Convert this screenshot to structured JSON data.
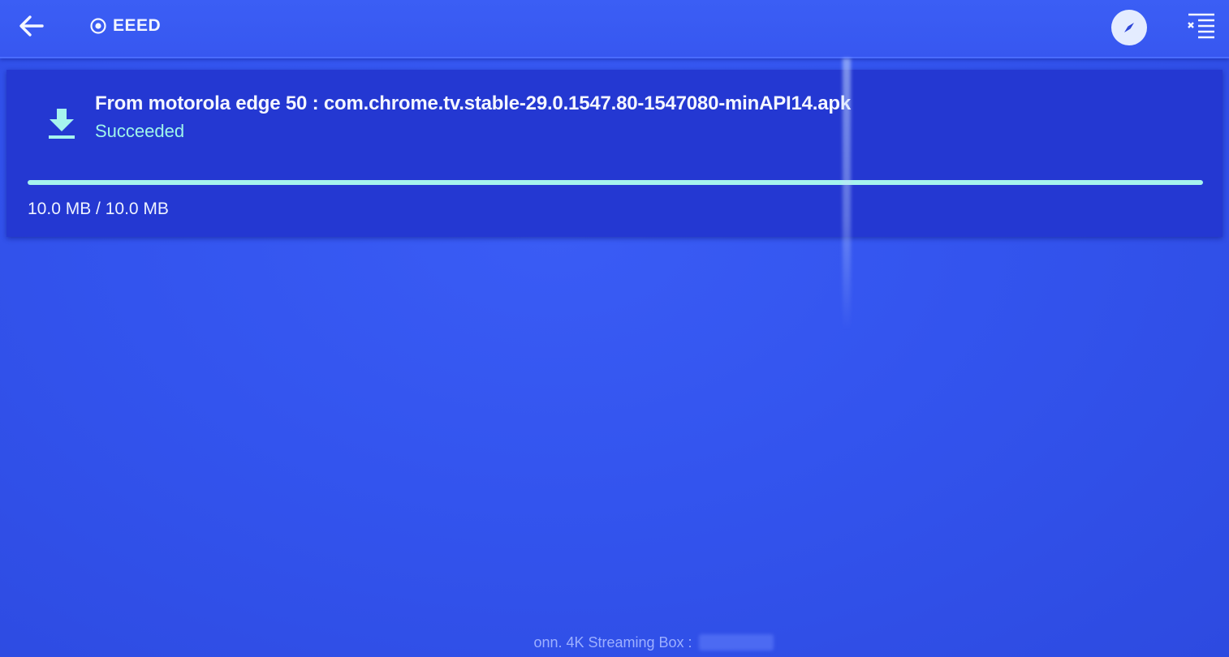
{
  "header": {
    "back_icon": "arrow-left-icon",
    "brand_icon": "target-icon",
    "brand_label": "EEED",
    "explore_icon": "compass-icon",
    "clear_icon": "clear-list-icon"
  },
  "download": {
    "icon": "download-icon",
    "title": "From motorola edge 50 : com.chrome.tv.stable-29.0.1547.80-1547080-minAPI14.apk",
    "status": "Succeeded",
    "progress_fraction": 1.0,
    "size_label": "10.0 MB / 10.0 MB"
  },
  "footer": {
    "device_label": "onn. 4K Streaming Box :"
  },
  "colors": {
    "background": "#3354ee",
    "card": "#2438d2",
    "accent": "#a6f3ee",
    "status_text": "#9ff5ea"
  }
}
